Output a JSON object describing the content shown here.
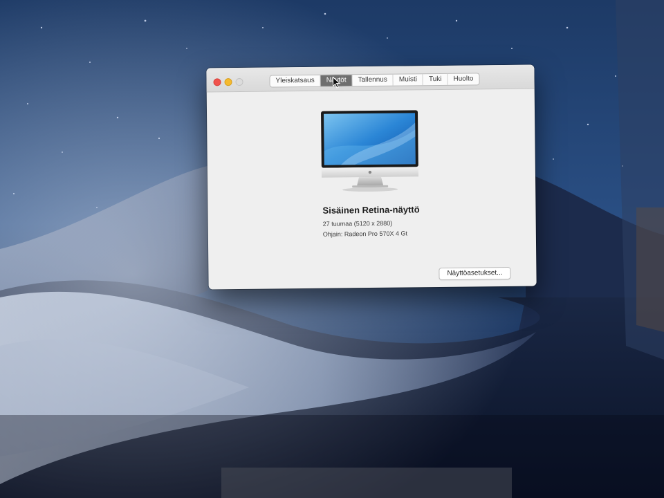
{
  "window": {
    "tabs": [
      {
        "label": "Yleiskatsaus"
      },
      {
        "label": "Näytöt"
      },
      {
        "label": "Tallennus"
      },
      {
        "label": "Muisti"
      },
      {
        "label": "Tuki"
      },
      {
        "label": "Huolto"
      }
    ],
    "active_tab": "Näytöt"
  },
  "display": {
    "name": "Sisäinen Retina-näyttö",
    "size": "27 tuumaa (5120 x 2880)",
    "gpu": "Ohjain: Radeon Pro 570X 4 Gt"
  },
  "actions": {
    "settings_label": "Näyttöasetukset..."
  },
  "colors": {
    "close": "#f0524c",
    "minimize": "#f5ba2f",
    "zoom_inactive": "#dcdcdc",
    "active_tab": "#6f6f6f"
  }
}
